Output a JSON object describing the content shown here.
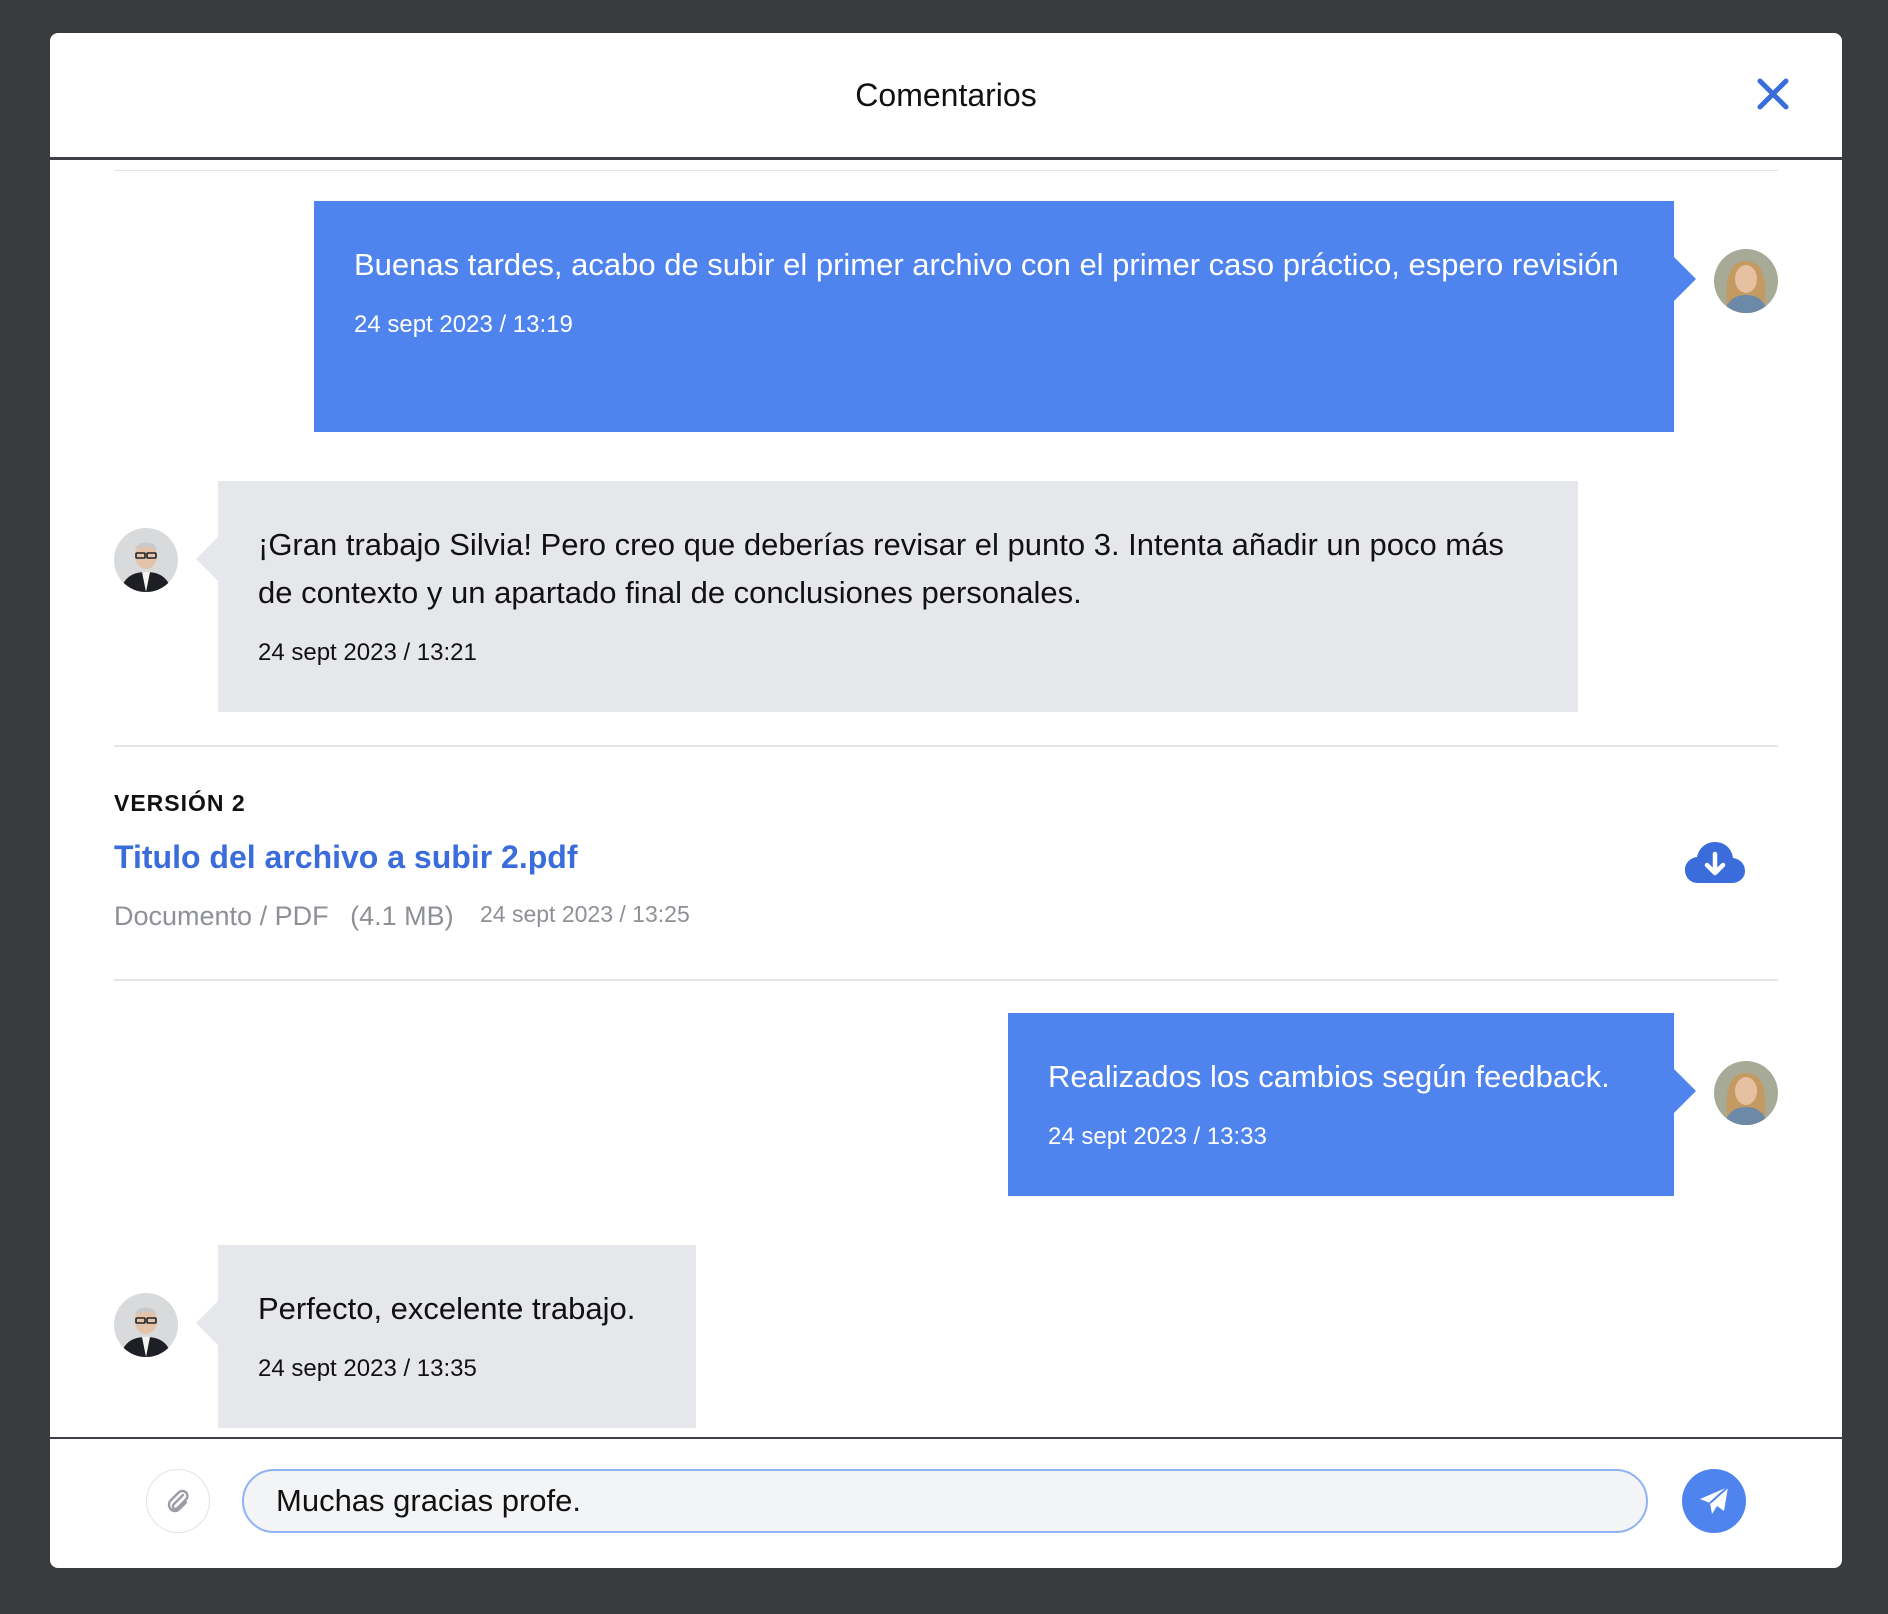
{
  "header": {
    "title": "Comentarios"
  },
  "icons": {
    "close": "close-icon",
    "download": "cloud-download-icon",
    "attach": "paperclip-icon",
    "send": "paper-plane-icon"
  },
  "colors": {
    "accent": "#4f83ed",
    "link": "#3a6cdc",
    "incoming_bubble": "#e6e7ea",
    "backdrop": "#3a3b3d"
  },
  "messages": [
    {
      "direction": "out",
      "text": "Buenas tardes, acabo de subir el primer archivo con el primer caso práctico, espero revisión",
      "time": "24 sept 2023 / 13:19"
    },
    {
      "direction": "in",
      "text": "¡Gran trabajo Silvia! Pero creo que deberías revisar el punto 3. Intenta añadir un poco más de contexto y un apartado final de conclusiones personales.",
      "time": "24 sept 2023 / 13:21"
    },
    {
      "direction": "out",
      "text": "Realizados los cambios según feedback.",
      "time": "24 sept 2023 / 13:33"
    },
    {
      "direction": "in",
      "text": "Perfecto, excelente trabajo.",
      "time": "24 sept 2023 / 13:35"
    }
  ],
  "version": {
    "label": "VERSIÓN 2",
    "file_name": "Titulo del archivo a subir 2.pdf",
    "file_type": "Documento / PDF",
    "file_size": "(4.1 MB)",
    "uploaded_at": "24 sept 2023 / 13:25"
  },
  "composer": {
    "value": "Muchas gracias profe."
  }
}
